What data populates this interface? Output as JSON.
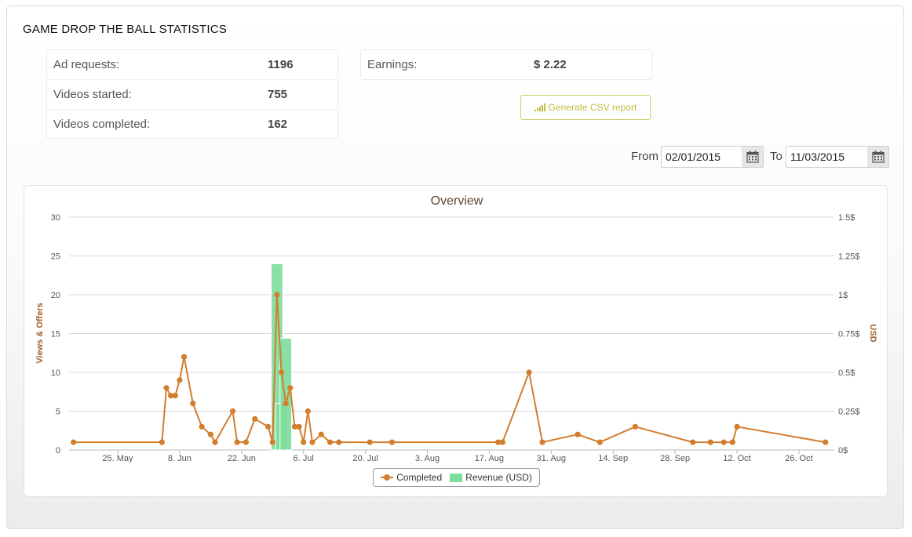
{
  "page": {
    "title": "GAME DROP THE BALL STATISTICS"
  },
  "stats": [
    {
      "label": "Ad requests:",
      "value": "1196"
    },
    {
      "label": "Videos started:",
      "value": "755"
    },
    {
      "label": "Videos completed:",
      "value": "162"
    }
  ],
  "earnings": {
    "label": "Earnings:",
    "value": "$ 2.22"
  },
  "csv_button": {
    "label": "Generate CSV report",
    "icon": "bar-chart-icon"
  },
  "date_range": {
    "from_label": "From",
    "from_value": "02/01/2015",
    "to_label": "To",
    "to_value": "11/03/2015",
    "calendar_icon": "calendar-icon"
  },
  "colors": {
    "completed": "#d37d2e",
    "revenue": "#7ddc9a",
    "axis_title": "#a0622d",
    "csv_accent": "#c2bd3b"
  },
  "chart_data": {
    "type": "line",
    "title": "Overview",
    "ylabel": "Views & Offers",
    "y2label": "USD",
    "ylim": [
      0,
      30
    ],
    "y2lim": [
      0,
      1.5
    ],
    "y_ticks": [
      "0",
      "5",
      "10",
      "15",
      "20",
      "25",
      "30"
    ],
    "y2_ticks": [
      "0$",
      "0.25$",
      "0.5$",
      "0.75$",
      "1$",
      "1.25$",
      "1.5$"
    ],
    "x_range": [
      "2015-05-14",
      "2015-11-03"
    ],
    "x_ticks": [
      {
        "date": "2015-05-25",
        "label": "25. May"
      },
      {
        "date": "2015-06-08",
        "label": "8. Jun"
      },
      {
        "date": "2015-06-22",
        "label": "22. Jun"
      },
      {
        "date": "2015-07-06",
        "label": "6. Jul"
      },
      {
        "date": "2015-07-20",
        "label": "20. Jul"
      },
      {
        "date": "2015-08-03",
        "label": "3. Aug"
      },
      {
        "date": "2015-08-17",
        "label": "17. Aug"
      },
      {
        "date": "2015-08-31",
        "label": "31. Aug"
      },
      {
        "date": "2015-09-14",
        "label": "14. Sep"
      },
      {
        "date": "2015-09-28",
        "label": "28. Sep"
      },
      {
        "date": "2015-10-12",
        "label": "12. Oct"
      },
      {
        "date": "2015-10-26",
        "label": "26. Oct"
      }
    ],
    "grid": true,
    "legend_position": "bottom-center",
    "series": [
      {
        "name": "Completed",
        "type": "line",
        "axis": "left",
        "points": [
          {
            "x": "2015-05-15",
            "y": 1
          },
          {
            "x": "2015-06-04",
            "y": 1
          },
          {
            "x": "2015-06-05",
            "y": 8
          },
          {
            "x": "2015-06-06",
            "y": 7
          },
          {
            "x": "2015-06-07",
            "y": 7
          },
          {
            "x": "2015-06-08",
            "y": 9
          },
          {
            "x": "2015-06-09",
            "y": 12
          },
          {
            "x": "2015-06-11",
            "y": 6
          },
          {
            "x": "2015-06-13",
            "y": 3
          },
          {
            "x": "2015-06-15",
            "y": 2
          },
          {
            "x": "2015-06-16",
            "y": 1
          },
          {
            "x": "2015-06-20",
            "y": 5
          },
          {
            "x": "2015-06-21",
            "y": 1
          },
          {
            "x": "2015-06-23",
            "y": 1
          },
          {
            "x": "2015-06-25",
            "y": 4
          },
          {
            "x": "2015-06-28",
            "y": 3
          },
          {
            "x": "2015-06-29",
            "y": 1
          },
          {
            "x": "2015-06-30",
            "y": 20
          },
          {
            "x": "2015-07-01",
            "y": 10
          },
          {
            "x": "2015-07-02",
            "y": 6
          },
          {
            "x": "2015-07-03",
            "y": 8
          },
          {
            "x": "2015-07-04",
            "y": 3
          },
          {
            "x": "2015-07-05",
            "y": 3
          },
          {
            "x": "2015-07-06",
            "y": 1
          },
          {
            "x": "2015-07-07",
            "y": 5
          },
          {
            "x": "2015-07-08",
            "y": 1
          },
          {
            "x": "2015-07-10",
            "y": 2
          },
          {
            "x": "2015-07-12",
            "y": 1
          },
          {
            "x": "2015-07-14",
            "y": 1
          },
          {
            "x": "2015-07-21",
            "y": 1
          },
          {
            "x": "2015-07-26",
            "y": 1
          },
          {
            "x": "2015-08-19",
            "y": 1
          },
          {
            "x": "2015-08-20",
            "y": 1
          },
          {
            "x": "2015-08-26",
            "y": 10
          },
          {
            "x": "2015-08-29",
            "y": 1
          },
          {
            "x": "2015-09-06",
            "y": 2
          },
          {
            "x": "2015-09-11",
            "y": 1
          },
          {
            "x": "2015-09-19",
            "y": 3
          },
          {
            "x": "2015-10-02",
            "y": 1
          },
          {
            "x": "2015-10-06",
            "y": 1
          },
          {
            "x": "2015-10-09",
            "y": 1
          },
          {
            "x": "2015-10-11",
            "y": 1
          },
          {
            "x": "2015-10-12",
            "y": 3
          },
          {
            "x": "2015-11-01",
            "y": 1
          }
        ]
      },
      {
        "name": "Revenue (USD)",
        "type": "bar",
        "axis": "right",
        "points": [
          {
            "x": "2015-06-30",
            "y": 1.2
          },
          {
            "x": "2015-07-01",
            "y": 0.3
          },
          {
            "x": "2015-07-02",
            "y": 0.72
          }
        ]
      }
    ]
  }
}
